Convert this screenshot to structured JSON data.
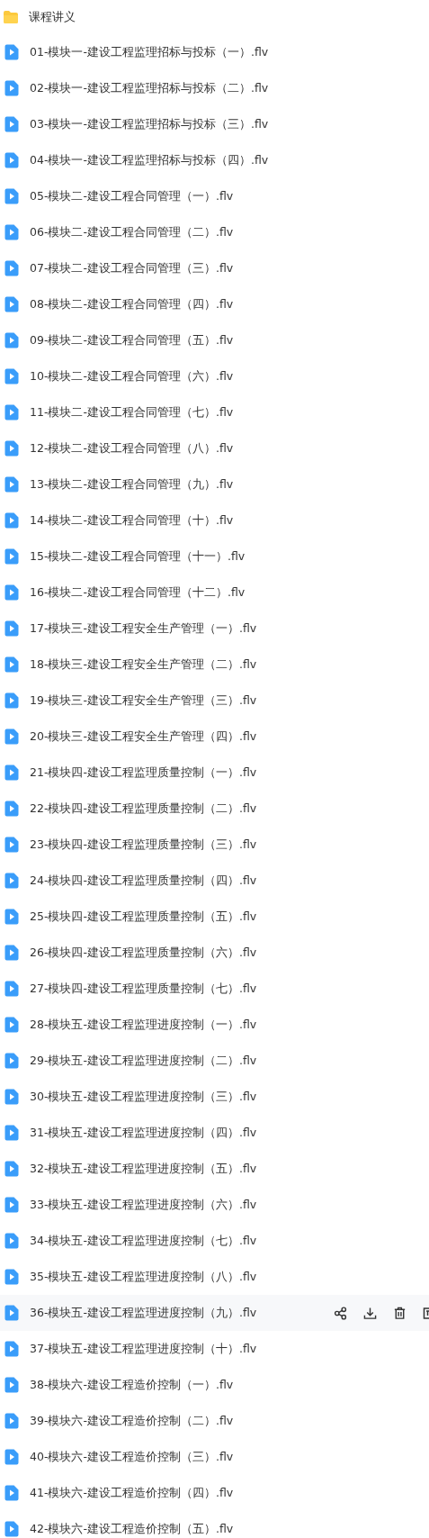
{
  "folder": {
    "name": "课程讲义"
  },
  "files": [
    {
      "name": "01-模块一-建设工程监理招标与投标（一）.flv",
      "hovered": false
    },
    {
      "name": "02-模块一-建设工程监理招标与投标（二）.flv",
      "hovered": false
    },
    {
      "name": "03-模块一-建设工程监理招标与投标（三）.flv",
      "hovered": false
    },
    {
      "name": "04-模块一-建设工程监理招标与投标（四）.flv",
      "hovered": false
    },
    {
      "name": "05-模块二-建设工程合同管理（一）.flv",
      "hovered": false
    },
    {
      "name": "06-模块二-建设工程合同管理（二）.flv",
      "hovered": false
    },
    {
      "name": "07-模块二-建设工程合同管理（三）.flv",
      "hovered": false
    },
    {
      "name": "08-模块二-建设工程合同管理（四）.flv",
      "hovered": false
    },
    {
      "name": "09-模块二-建设工程合同管理（五）.flv",
      "hovered": false
    },
    {
      "name": "10-模块二-建设工程合同管理（六）.flv",
      "hovered": false
    },
    {
      "name": "11-模块二-建设工程合同管理（七）.flv",
      "hovered": false
    },
    {
      "name": "12-模块二-建设工程合同管理（八）.flv",
      "hovered": false
    },
    {
      "name": "13-模块二-建设工程合同管理（九）.flv",
      "hovered": false
    },
    {
      "name": "14-模块二-建设工程合同管理（十）.flv",
      "hovered": false
    },
    {
      "name": "15-模块二-建设工程合同管理（十一）.flv",
      "hovered": false
    },
    {
      "name": "16-模块二-建设工程合同管理（十二）.flv",
      "hovered": false
    },
    {
      "name": "17-模块三-建设工程安全生产管理（一）.flv",
      "hovered": false
    },
    {
      "name": "18-模块三-建设工程安全生产管理（二）.flv",
      "hovered": false
    },
    {
      "name": "19-模块三-建设工程安全生产管理（三）.flv",
      "hovered": false
    },
    {
      "name": "20-模块三-建设工程安全生产管理（四）.flv",
      "hovered": false
    },
    {
      "name": "21-模块四-建设工程监理质量控制（一）.flv",
      "hovered": false
    },
    {
      "name": "22-模块四-建设工程监理质量控制（二）.flv",
      "hovered": false
    },
    {
      "name": "23-模块四-建设工程监理质量控制（三）.flv",
      "hovered": false
    },
    {
      "name": "24-模块四-建设工程监理质量控制（四）.flv",
      "hovered": false
    },
    {
      "name": "25-模块四-建设工程监理质量控制（五）.flv",
      "hovered": false
    },
    {
      "name": "26-模块四-建设工程监理质量控制（六）.flv",
      "hovered": false
    },
    {
      "name": "27-模块四-建设工程监理质量控制（七）.flv",
      "hovered": false
    },
    {
      "name": "28-模块五-建设工程监理进度控制（一）.flv",
      "hovered": false
    },
    {
      "name": "29-模块五-建设工程监理进度控制（二）.flv",
      "hovered": false
    },
    {
      "name": "30-模块五-建设工程监理进度控制（三）.flv",
      "hovered": false
    },
    {
      "name": "31-模块五-建设工程监理进度控制（四）.flv",
      "hovered": false
    },
    {
      "name": "32-模块五-建设工程监理进度控制（五）.flv",
      "hovered": false
    },
    {
      "name": "33-模块五-建设工程监理进度控制（六）.flv",
      "hovered": false
    },
    {
      "name": "34-模块五-建设工程监理进度控制（七）.flv",
      "hovered": false
    },
    {
      "name": "35-模块五-建设工程监理进度控制（八）.flv",
      "hovered": false
    },
    {
      "name": "36-模块五-建设工程监理进度控制（九）.flv",
      "hovered": true
    },
    {
      "name": "37-模块五-建设工程监理进度控制（十）.flv",
      "hovered": false
    },
    {
      "name": "38-模块六-建设工程造价控制（一）.flv",
      "hovered": false
    },
    {
      "name": "39-模块六-建设工程造价控制（二）.flv",
      "hovered": false
    },
    {
      "name": "40-模块六-建设工程造价控制（三）.flv",
      "hovered": false
    },
    {
      "name": "41-模块六-建设工程造价控制（四）.flv",
      "hovered": false
    },
    {
      "name": "42-模块六-建设工程造价控制（五）.flv",
      "hovered": false
    }
  ]
}
